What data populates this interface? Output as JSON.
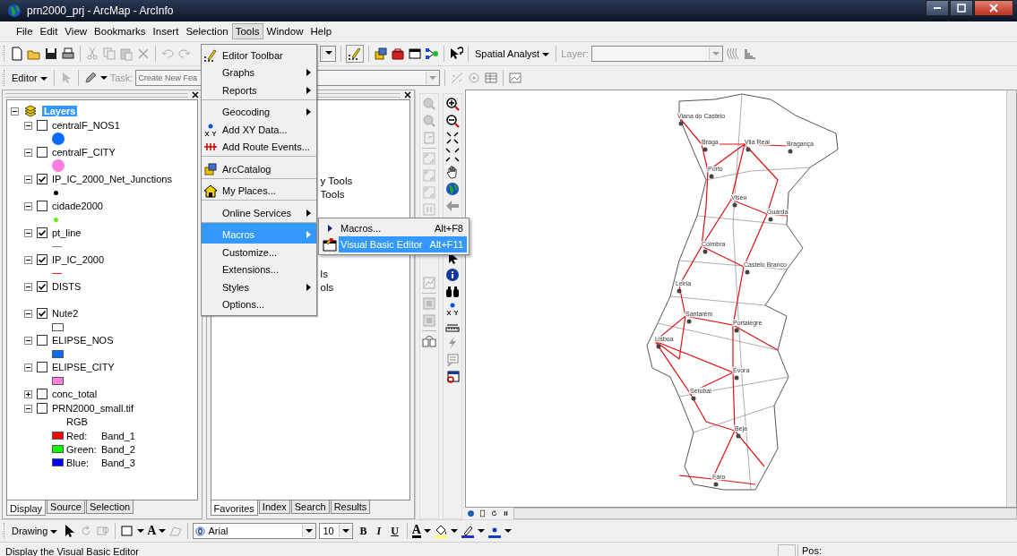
{
  "window": {
    "title": "prn2000_prj - ArcMap - ArcInfo"
  },
  "menu_bar": [
    {
      "label": "File",
      "selected": false
    },
    {
      "label": "Edit",
      "selected": false
    },
    {
      "label": "View",
      "selected": false
    },
    {
      "label": "Bookmarks",
      "selected": false
    },
    {
      "label": "Insert",
      "selected": false
    },
    {
      "label": "Selection",
      "selected": false
    },
    {
      "label": "Tools",
      "selected": true
    },
    {
      "label": "Window",
      "selected": false
    },
    {
      "label": "Help",
      "selected": false
    }
  ],
  "standard_toolbar": {
    "spatial_analyst": "Spatial Analyst",
    "layer_label": "Layer:"
  },
  "editor_toolbar": {
    "editor": "Editor",
    "task_label": "Task:",
    "task_value": "Create New Fea"
  },
  "toc": {
    "root": {
      "label": "Layers",
      "selected": true,
      "expanded": true
    },
    "layers": [
      {
        "name": "centralF_NOS1",
        "checked": false,
        "expanded": true,
        "kind": "circle",
        "color": "#0a6cff"
      },
      {
        "name": "centralF_CITY",
        "checked": false,
        "expanded": true,
        "kind": "circle",
        "color": "#ff7ee0"
      },
      {
        "name": "IP_IC_2000_Net_Junctions",
        "checked": true,
        "expanded": true,
        "kind": "dot",
        "color": "#000000"
      },
      {
        "name": "cidade2000",
        "checked": false,
        "expanded": true,
        "kind": "dot",
        "color": "#66ee00"
      },
      {
        "name": "pt_line",
        "checked": true,
        "expanded": true,
        "kind": "line",
        "color": "#808080"
      },
      {
        "name": "IP_IC_2000",
        "checked": true,
        "expanded": true,
        "kind": "line",
        "color": "#ff2020"
      },
      {
        "name": "DISTS",
        "checked": true,
        "expanded": true,
        "kind": "none"
      },
      {
        "name": "Nute2",
        "checked": true,
        "expanded": true,
        "kind": "fill",
        "color": "#ffffff"
      },
      {
        "name": "ELIPSE_NOS",
        "checked": false,
        "expanded": true,
        "kind": "fill",
        "color": "#0a6cff"
      },
      {
        "name": "ELIPSE_CITY",
        "checked": false,
        "expanded": true,
        "kind": "fill",
        "color": "#ff7ee0"
      },
      {
        "name": "conc_total",
        "checked": false,
        "expanded": false
      },
      {
        "name": "PRN2000_small.tif",
        "checked": false,
        "expanded": true,
        "kind": "raster",
        "heading": "RGB",
        "bands": [
          {
            "channel": "Red:",
            "band": "Band_1",
            "color": "#ff0000"
          },
          {
            "channel": "Green:",
            "band": "Band_2",
            "color": "#00ff00"
          },
          {
            "channel": "Blue:",
            "band": "Band_3",
            "color": "#0000ff"
          }
        ]
      }
    ],
    "tabs": [
      {
        "label": "Display",
        "selected": true
      },
      {
        "label": "Source",
        "selected": false
      },
      {
        "label": "Selection",
        "selected": false
      }
    ]
  },
  "catalog": {
    "visible_texts": [
      "y Tools",
      "Tools",
      "ls",
      "ols"
    ],
    "tabs": [
      {
        "label": "Favorites",
        "selected": true
      },
      {
        "label": "Index",
        "selected": false
      },
      {
        "label": "Search",
        "selected": false
      },
      {
        "label": "Results",
        "selected": false
      }
    ]
  },
  "tools_menu": [
    {
      "label": "Editor Toolbar",
      "kind": "editor",
      "submenu": false,
      "separator_before": false,
      "selected": false
    },
    {
      "label": "Graphs",
      "kind": "plain",
      "submenu": true,
      "separator_before": false,
      "selected": false
    },
    {
      "label": "Reports",
      "kind": "plain",
      "submenu": true,
      "separator_before": false,
      "selected": false
    },
    {
      "label": "Geocoding",
      "kind": "plain",
      "submenu": true,
      "separator_before": true,
      "selected": false
    },
    {
      "label": "Add XY Data...",
      "kind": "xy",
      "submenu": false,
      "separator_before": false,
      "selected": false
    },
    {
      "label": "Add Route Events...",
      "kind": "route",
      "submenu": false,
      "separator_before": false,
      "selected": false
    },
    {
      "label": "ArcCatalog",
      "kind": "catalog",
      "submenu": false,
      "separator_before": true,
      "selected": false
    },
    {
      "label": "My Places...",
      "kind": "home",
      "submenu": false,
      "separator_before": true,
      "selected": false
    },
    {
      "label": "Online Services",
      "kind": "plain",
      "submenu": true,
      "separator_before": true,
      "selected": false
    },
    {
      "label": "Macros",
      "kind": "plain",
      "submenu": true,
      "separator_before": true,
      "selected": true
    },
    {
      "label": "Customize...",
      "kind": "plain",
      "submenu": false,
      "separator_before": false,
      "selected": false
    },
    {
      "label": "Extensions...",
      "kind": "plain",
      "submenu": false,
      "separator_before": false,
      "selected": false
    },
    {
      "label": "Styles",
      "kind": "plain",
      "submenu": true,
      "separator_before": false,
      "selected": false
    },
    {
      "label": "Options...",
      "kind": "plain",
      "submenu": false,
      "separator_before": false,
      "selected": false
    }
  ],
  "macros_submenu": [
    {
      "label": "Macros...",
      "shortcut": "Alt+F8",
      "kind": "triangle",
      "selected": false
    },
    {
      "label": "Visual Basic Editor",
      "shortcut": "Alt+F11",
      "kind": "vbe",
      "selected": true
    }
  ],
  "map": {
    "places": [
      "Viana do Castelo",
      "Braga",
      "Vila Real",
      "Bragança",
      "Porto",
      "Viseu",
      "Guarda",
      "Coimbra",
      "Castelo Branco",
      "Leiria",
      "Santarém",
      "Portalegre",
      "Lisboa",
      "Évora",
      "Setúbal",
      "Beja",
      "Faro"
    ]
  },
  "drawing_toolbar": {
    "label": "Drawing",
    "text_tool": "A",
    "font": "Arial",
    "font_size": "10",
    "bold": "B",
    "italic": "I",
    "underline": "U",
    "font_color": "A"
  },
  "status_bar": {
    "message": "Display the Visual Basic Editor",
    "position_label": "Pos:"
  }
}
